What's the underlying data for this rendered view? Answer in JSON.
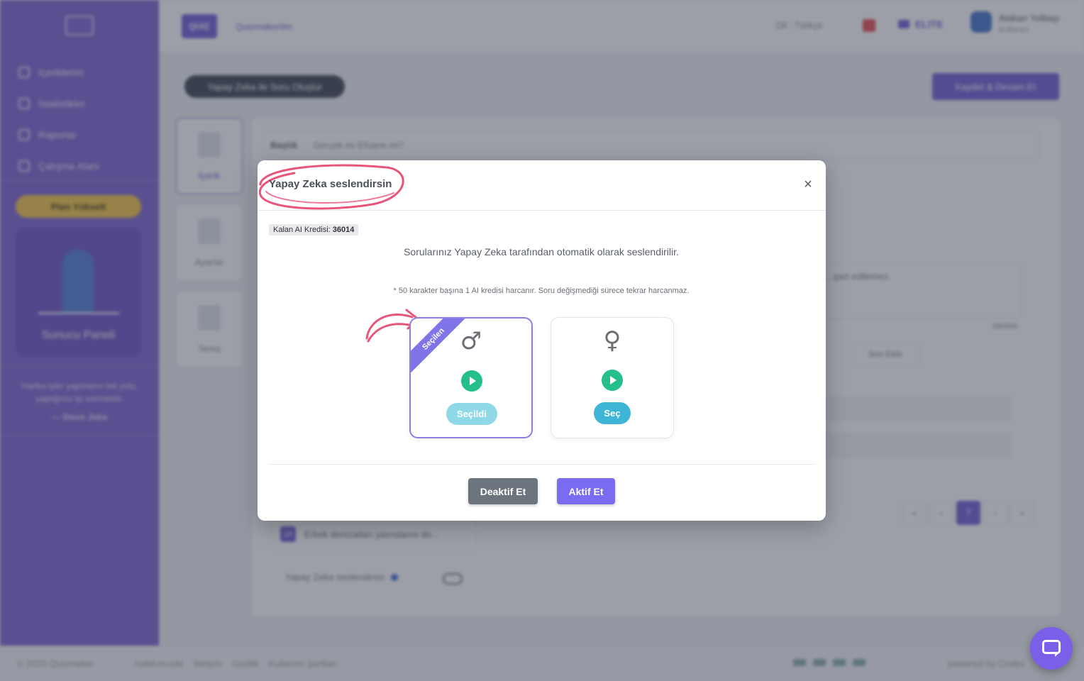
{
  "sidebar": {
    "nav": [
      {
        "label": "İçeriklerim",
        "icon": "content-icon"
      },
      {
        "label": "İstatistikler",
        "icon": "chart-icon"
      },
      {
        "label": "Raporlar",
        "icon": "report-icon"
      },
      {
        "label": "Çalışma Alanı",
        "icon": "workspace-icon"
      }
    ],
    "upgrade_label": "Plan Yükselt",
    "presenter_label": "Sunucu Paneli",
    "quote": "Harika işler yapmanın tek yolu, yaptığınız işi sevmektir.",
    "quote_author": "— Steve Jobs"
  },
  "topbar": {
    "logo": "QUIZ",
    "breadcrumb": "Quizmakerlim",
    "language": "Dil : Türkçe",
    "plan": "ELITE",
    "user_name": "Atakan Yolbaşı",
    "user_role": "Kullanıcı"
  },
  "editor": {
    "back_label": "Yapay Zeka ile Soru Oluştur",
    "save_label": "Kaydet & Devam Et",
    "steps": [
      "İçerik",
      "Ayarlar",
      "Tema"
    ],
    "title_label": "Başlık",
    "title_value": "Gerçek mi Efsane mi?",
    "hint_text": "...şart edilemez.",
    "char_count": "195/500",
    "edit_question": "Son Ekle",
    "question_item_num": "10",
    "question_item_text": "Erkek denizatları yavrularını do...",
    "voice_row_label": "Yapay Zeka seslendirsin",
    "pager": [
      "«",
      "‹",
      "7",
      "›",
      "»"
    ]
  },
  "modal": {
    "title": "Yapay Zeka seslendirsin",
    "close_symbol": "×",
    "credit_label": "Kalan AI Kredisi:",
    "credit_value": "36014",
    "description": "Sorularınız Yapay Zeka tarafından otomatik olarak seslendirilir.",
    "note": "* 50 karakter başına 1 AI kredisi harcanır. Soru değişmediği sürece tekrar harcanmaz.",
    "voices": [
      {
        "symbol": "♂",
        "button_label": "Seçildi",
        "ribbon": "Seçilen",
        "selected": true
      },
      {
        "symbol": "♀",
        "button_label": "Seç",
        "selected": false
      }
    ],
    "deactivate_label": "Deaktif Et",
    "activate_label": "Aktif Et"
  },
  "footer": {
    "copyright": "© 2025 Quizmaker",
    "links": [
      "Hakkımızda",
      "İletişim",
      "Gizlilik",
      "Kullanım Şartları"
    ],
    "powered": "powered by Codex"
  },
  "colors": {
    "brand": "#7b5fd0",
    "accent": "#7a6cf0",
    "play": "#25c08a",
    "select": "#3eb4d6",
    "highlight_scribble": "#e8557a"
  }
}
